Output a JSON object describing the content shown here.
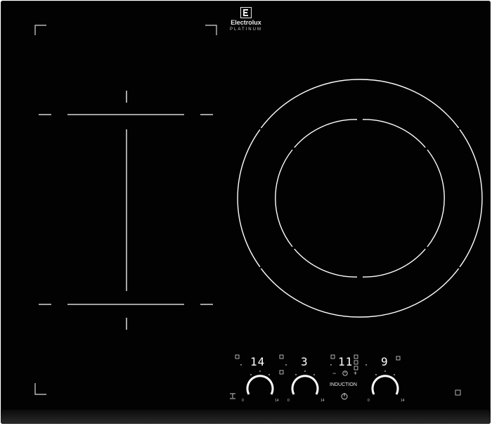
{
  "brand": {
    "logo_icon": "electrolux-e-logo-icon",
    "name": "Electrolux",
    "subtitle": "PLATINUM"
  },
  "zones": {
    "left_display": "14",
    "middle_display": "3",
    "timer_display": "11",
    "right_display": "9"
  },
  "controls": {
    "timer_minus": "−",
    "timer_plus": "+",
    "timer_icon": "clock-icon",
    "induction_label": "INDUCTION",
    "power_icon": "power-icon",
    "slider_scale_min": "0",
    "slider_scale_max": "14"
  },
  "colors": {
    "glass": "#020202",
    "markings": "#ffffff"
  }
}
